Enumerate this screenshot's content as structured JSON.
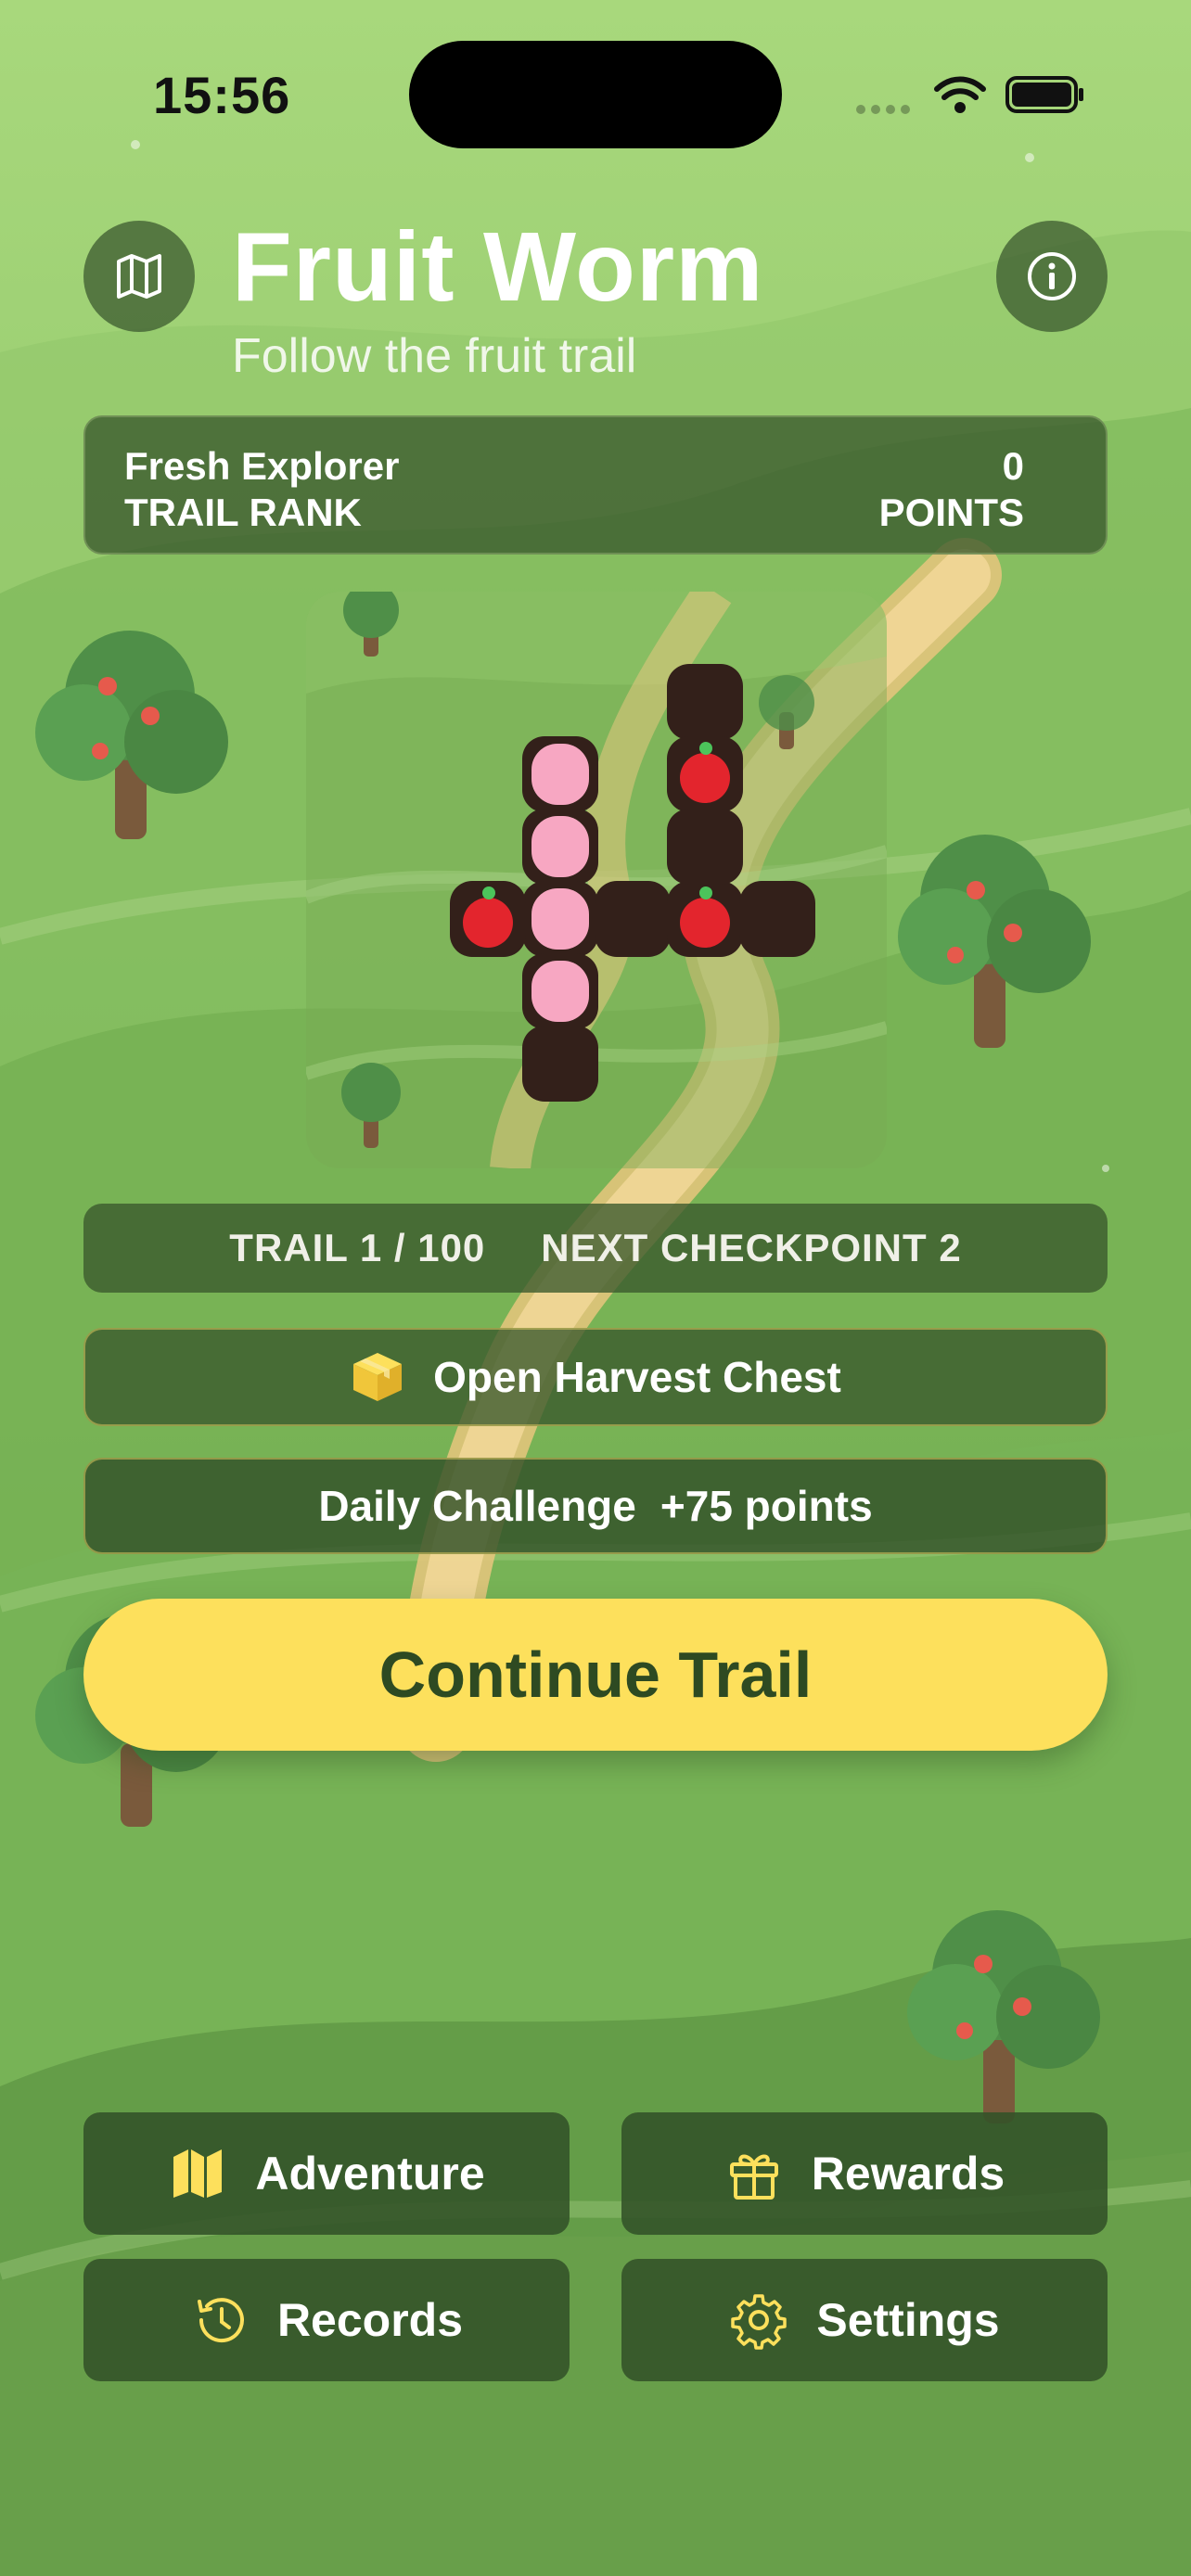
{
  "status_bar": {
    "time": "15:56",
    "icons": [
      "cellular-dots-icon",
      "wifi-icon",
      "battery-icon"
    ]
  },
  "header": {
    "title": "Fruit Worm",
    "subtitle": "Follow the fruit trail",
    "left_icon": "map-icon",
    "right_icon": "info-icon"
  },
  "rank": {
    "rank_name": "Fresh Explorer",
    "rank_label": "TRAIL RANK",
    "points_value": "0",
    "points_label": "POINTS"
  },
  "board": {
    "worm_body_cells": 6,
    "fruit_cells": 3,
    "fruit_type": "apple",
    "colors": {
      "worm": "#33201a",
      "worm_segment": "#f7a7c2",
      "apple": "#e3252d",
      "leaf": "#4cc45b"
    }
  },
  "trail": {
    "progress": "TRAIL 1 / 100",
    "checkpoint": "NEXT CHECKPOINT 2"
  },
  "chest": {
    "label": "Open Harvest Chest",
    "icon": "chest-icon"
  },
  "daily": {
    "label": "Daily Challenge",
    "reward": "+75 points"
  },
  "continue": {
    "label": "Continue Trail"
  },
  "nav": {
    "adventure": {
      "label": "Adventure",
      "icon": "map-icon"
    },
    "rewards": {
      "label": "Rewards",
      "icon": "gift-icon"
    },
    "records": {
      "label": "Records",
      "icon": "history-icon"
    },
    "settings": {
      "label": "Settings",
      "icon": "gear-icon"
    }
  },
  "colors": {
    "accent_yellow": "#fde05c",
    "button_dark_green": "#3a582d",
    "text_dark_green": "#2e4a22",
    "background_green": "#8cc46a"
  }
}
